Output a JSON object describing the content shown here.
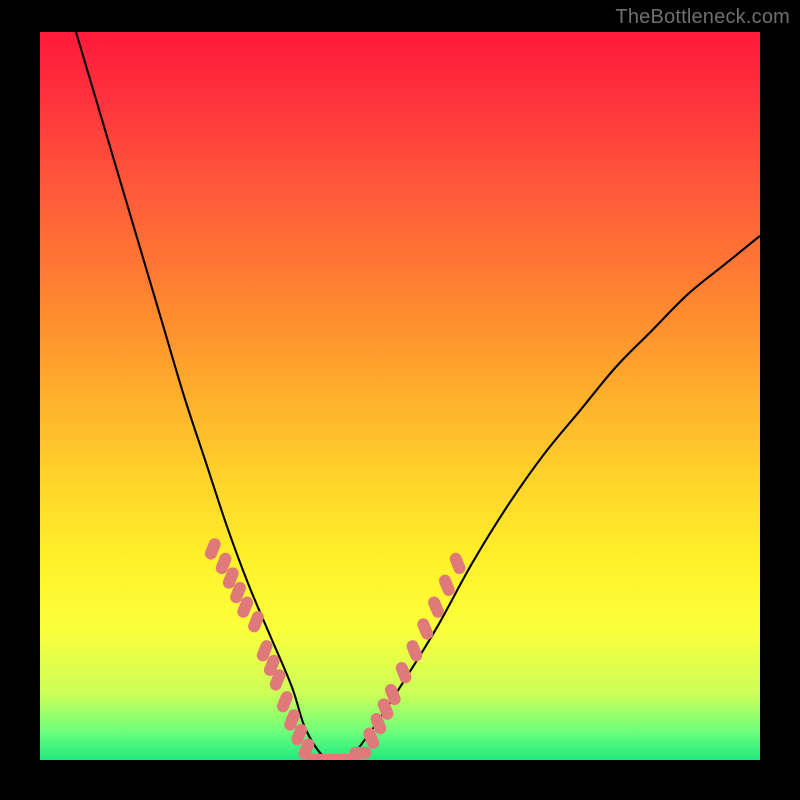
{
  "watermark": "TheBottleneck.com",
  "chart_data": {
    "type": "line",
    "title": "",
    "xlabel": "",
    "ylabel": "",
    "xlim": [
      0,
      100
    ],
    "ylim": [
      0,
      100
    ],
    "grid": false,
    "legend": false,
    "description": "V-shaped bottleneck curve over a vertical color gradient (red=high bottleneck, green=low bottleneck). Curve reaches its minimum near x≈37–40 where it touches the green zone.",
    "series": [
      {
        "name": "bottleneck-curve",
        "color": "#000000",
        "x": [
          5,
          8,
          11,
          14,
          17,
          20,
          23,
          26,
          29,
          32,
          35,
          37,
          40,
          43,
          46,
          50,
          55,
          60,
          65,
          70,
          75,
          80,
          85,
          90,
          95,
          100
        ],
        "y": [
          100,
          90,
          80,
          70,
          60,
          50,
          41,
          32,
          24,
          17,
          10,
          4,
          0,
          0.5,
          4,
          10,
          18,
          27,
          35,
          42,
          48,
          54,
          59,
          64,
          68,
          72
        ]
      },
      {
        "name": "left-markers",
        "type": "scatter",
        "color": "#e07a7a",
        "x": [
          24,
          25.5,
          26.5,
          27.5,
          28.5,
          30,
          31.2,
          32.2,
          33,
          34,
          35,
          36,
          37
        ],
        "y": [
          29,
          27,
          25,
          23,
          21,
          19,
          15,
          13,
          11,
          8,
          5.5,
          3.5,
          1.5
        ]
      },
      {
        "name": "bottom-markers",
        "type": "scatter",
        "color": "#e07a7a",
        "x": [
          38.5,
          40,
          41.5,
          43,
          44.5
        ],
        "y": [
          0,
          0,
          0,
          0,
          1
        ]
      },
      {
        "name": "right-markers",
        "type": "scatter",
        "color": "#e07a7a",
        "x": [
          46,
          47,
          48,
          49,
          50.5,
          52,
          53.5,
          55,
          56.5,
          58
        ],
        "y": [
          3,
          5,
          7,
          9,
          12,
          15,
          18,
          21,
          24,
          27
        ]
      }
    ]
  }
}
